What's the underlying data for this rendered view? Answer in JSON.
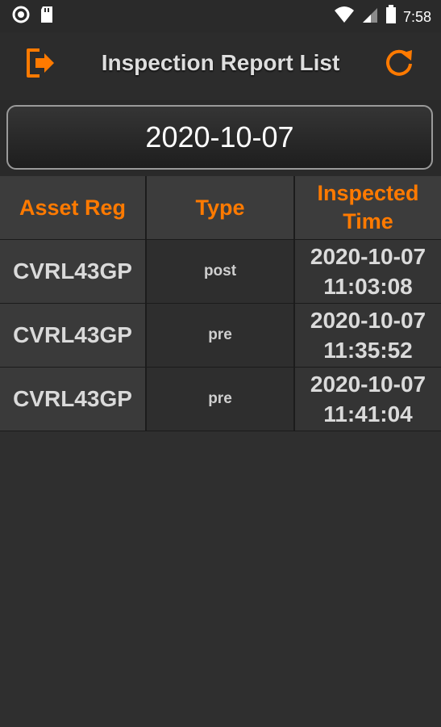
{
  "status_bar": {
    "time": "7:58"
  },
  "header": {
    "title": "Inspection Report List"
  },
  "date_selector": {
    "value": "2020-10-07"
  },
  "table": {
    "columns": [
      "Asset Reg",
      "Type",
      "Inspected",
      "Time"
    ],
    "rows": [
      {
        "asset_reg": "CVRL43GP",
        "type": "post",
        "date": "2020-10-07",
        "time": "11:03:08"
      },
      {
        "asset_reg": "CVRL43GP",
        "type": "pre",
        "date": "2020-10-07",
        "time": "11:35:52"
      },
      {
        "asset_reg": "CVRL43GP",
        "type": "pre",
        "date": "2020-10-07",
        "time": "11:41:04"
      }
    ]
  },
  "colors": {
    "accent": "#ff7a00",
    "background": "#2f2f2f"
  },
  "icons": {
    "exit": "logout-icon",
    "refresh": "refresh-icon"
  }
}
